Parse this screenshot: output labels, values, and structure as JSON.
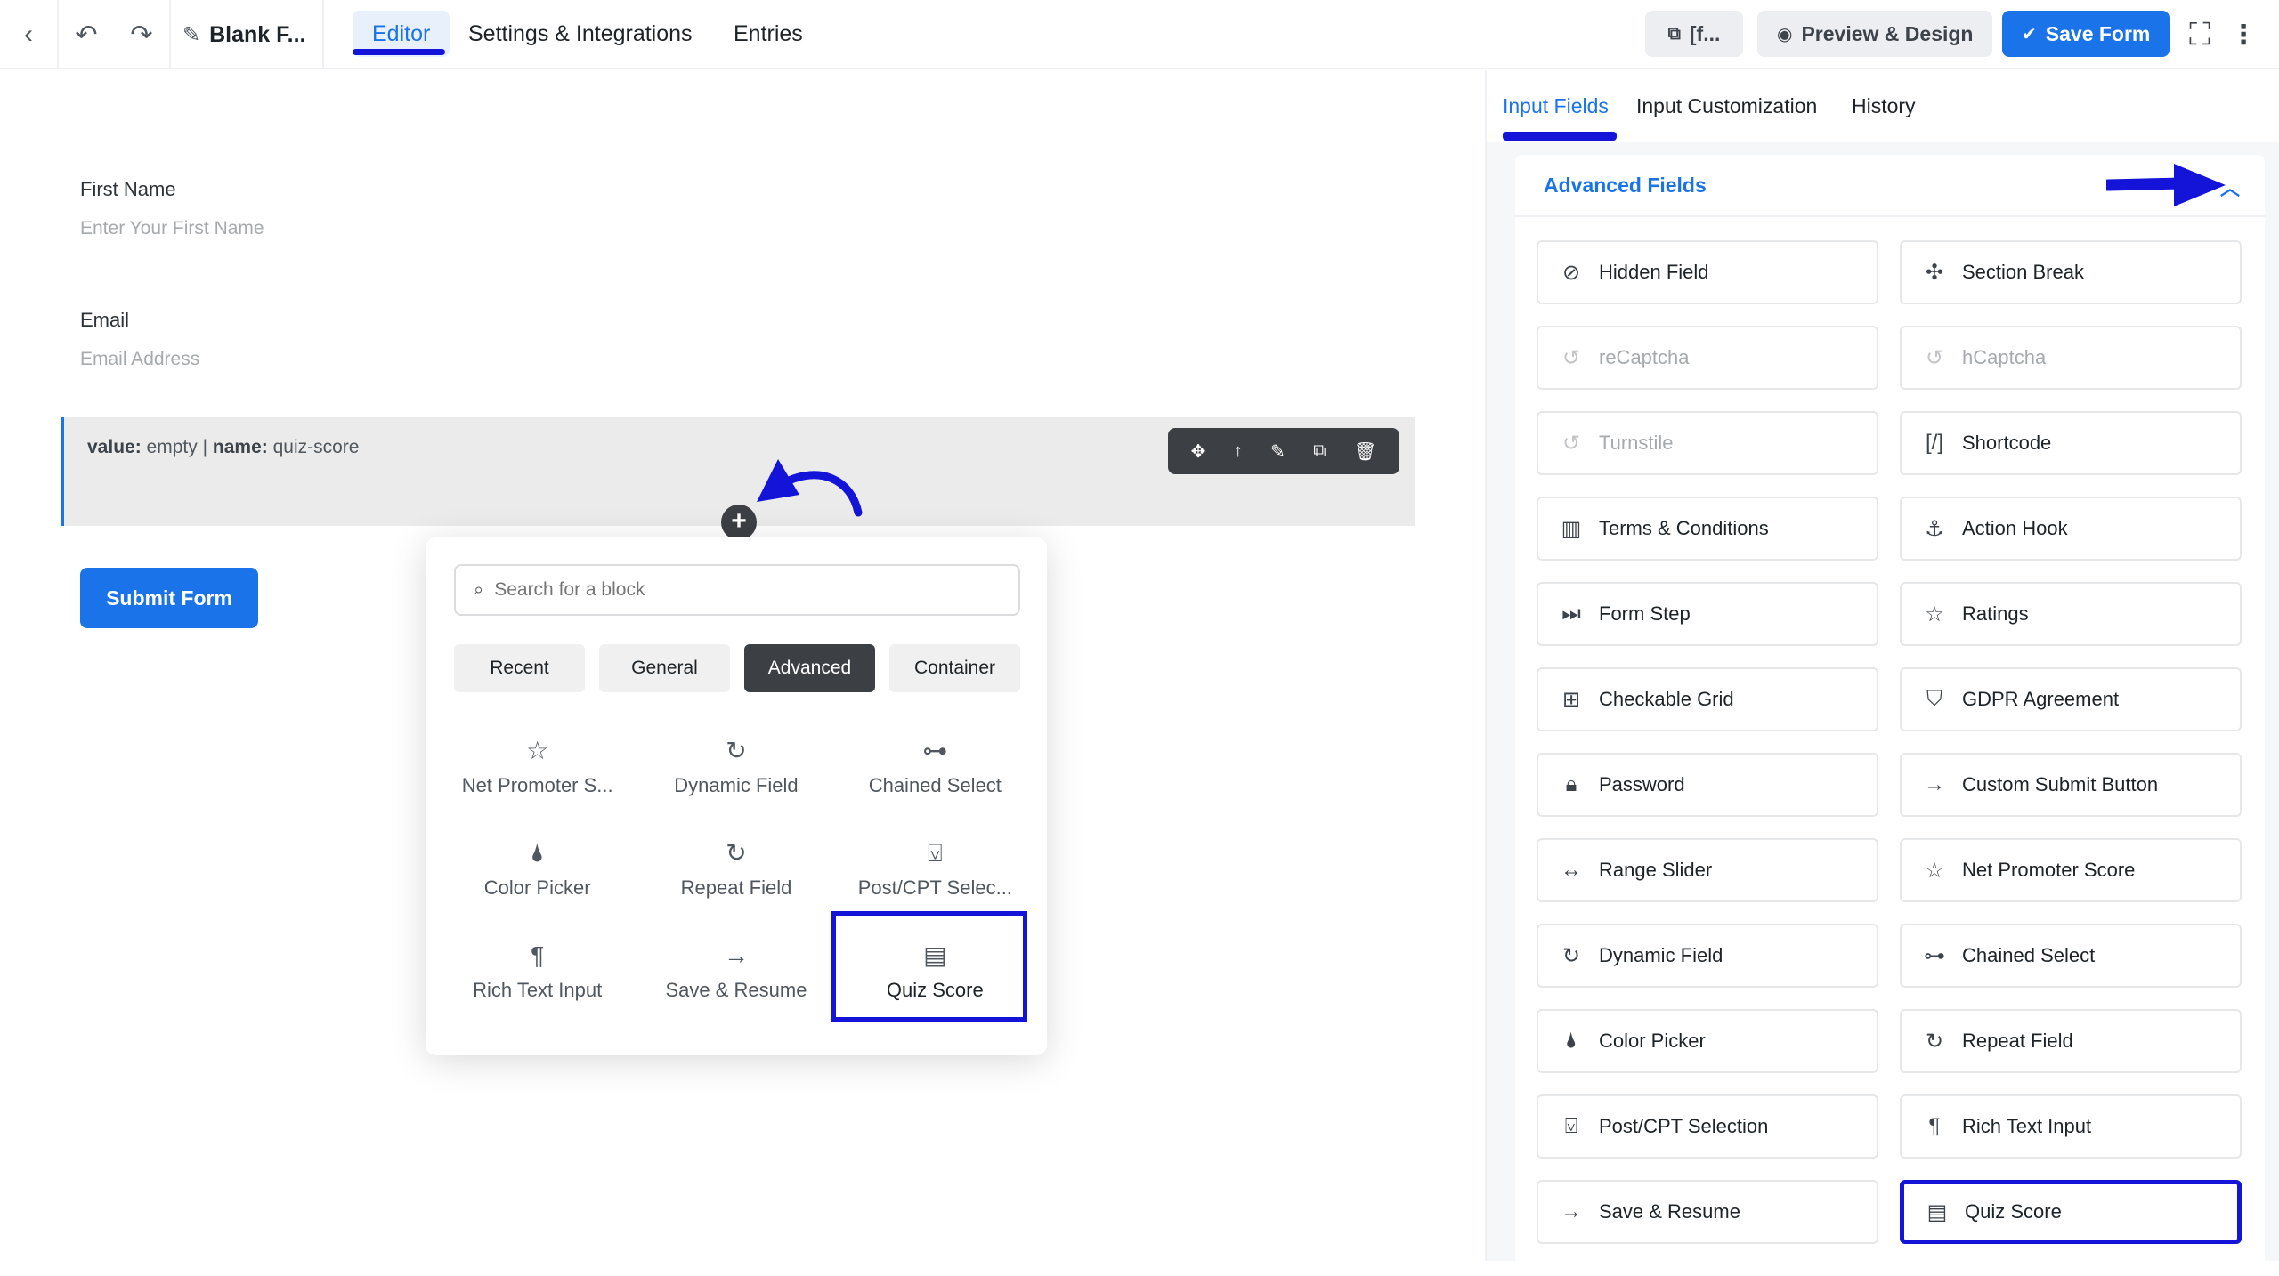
{
  "topbar": {
    "title": "Blank F...",
    "tabs": [
      {
        "label": "Editor",
        "active": true
      },
      {
        "label": "Settings & Integrations",
        "active": false
      },
      {
        "label": "Entries",
        "active": false
      }
    ],
    "shortcode_label": "[f...",
    "preview_label": "Preview & Design",
    "save_label": "Save Form"
  },
  "editor": {
    "fields": [
      {
        "label": "First Name",
        "placeholder": "Enter Your First Name"
      },
      {
        "label": "Email",
        "placeholder": "Email Address"
      }
    ],
    "quiz_block": {
      "value_key": "value:",
      "value": "empty",
      "sep": "|",
      "name_key": "name:",
      "name": "quiz-score"
    },
    "submit_label": "Submit Form"
  },
  "popover": {
    "search_placeholder": "Search for a block",
    "tabs": [
      {
        "label": "Recent",
        "active": false
      },
      {
        "label": "General",
        "active": false
      },
      {
        "label": "Advanced",
        "active": true
      },
      {
        "label": "Container",
        "active": false
      }
    ],
    "items": [
      {
        "label": "Net Promoter S...",
        "icon": "star-icon"
      },
      {
        "label": "Dynamic Field",
        "icon": "refresh-icon"
      },
      {
        "label": "Chained Select",
        "icon": "link-icon"
      },
      {
        "label": "Color Picker",
        "icon": "drop-icon"
      },
      {
        "label": "Repeat Field",
        "icon": "refresh-icon"
      },
      {
        "label": "Post/CPT Selec...",
        "icon": "dropdown-box-icon"
      },
      {
        "label": "Rich Text Input",
        "icon": "paragraph-icon"
      },
      {
        "label": "Save & Resume",
        "icon": "arrow-right-icon"
      },
      {
        "label": "Quiz Score",
        "icon": "score-card-icon"
      }
    ]
  },
  "right_panel": {
    "tabs": [
      {
        "label": "Input Fields",
        "active": true
      },
      {
        "label": "Input Customization",
        "active": false
      },
      {
        "label": "History",
        "active": false
      }
    ],
    "section_title": "Advanced Fields",
    "fields": [
      {
        "label": "Hidden Field",
        "icon": "eye-slash-icon",
        "enabled": true
      },
      {
        "label": "Section Break",
        "icon": "puzzle-icon",
        "enabled": true
      },
      {
        "label": "reCaptcha",
        "icon": "captcha-icon",
        "enabled": false
      },
      {
        "label": "hCaptcha",
        "icon": "captcha-icon",
        "enabled": false
      },
      {
        "label": "Turnstile",
        "icon": "captcha-icon",
        "enabled": false
      },
      {
        "label": "Shortcode",
        "icon": "shortcode-icon",
        "enabled": true
      },
      {
        "label": "Terms & Conditions",
        "icon": "document-icon",
        "enabled": true
      },
      {
        "label": "Action Hook",
        "icon": "hook-icon",
        "enabled": true
      },
      {
        "label": "Form Step",
        "icon": "step-forward-icon",
        "enabled": true
      },
      {
        "label": "Ratings",
        "icon": "star-icon",
        "enabled": true
      },
      {
        "label": "Checkable Grid",
        "icon": "grid-check-icon",
        "enabled": true
      },
      {
        "label": "GDPR Agreement",
        "icon": "shield-icon",
        "enabled": true
      },
      {
        "label": "Password",
        "icon": "lock-icon",
        "enabled": true
      },
      {
        "label": "Custom Submit Button",
        "icon": "arrow-right-icon",
        "enabled": true
      },
      {
        "label": "Range Slider",
        "icon": "range-icon",
        "enabled": true
      },
      {
        "label": "Net Promoter Score",
        "icon": "star-icon",
        "enabled": true
      },
      {
        "label": "Dynamic Field",
        "icon": "refresh-icon",
        "enabled": true
      },
      {
        "label": "Chained Select",
        "icon": "link-icon",
        "enabled": true
      },
      {
        "label": "Color Picker",
        "icon": "drop-icon",
        "enabled": true
      },
      {
        "label": "Repeat Field",
        "icon": "refresh-icon",
        "enabled": true
      },
      {
        "label": "Post/CPT Selection",
        "icon": "dropdown-box-icon",
        "enabled": true
      },
      {
        "label": "Rich Text Input",
        "icon": "paragraph-icon",
        "enabled": true
      },
      {
        "label": "Save & Resume",
        "icon": "arrow-right-icon",
        "enabled": true
      },
      {
        "label": "Quiz Score",
        "icon": "score-card-icon",
        "enabled": true
      }
    ]
  },
  "colors": {
    "accent": "#1a73e8",
    "annotation": "#1414d8",
    "dark": "#3c3f44"
  }
}
